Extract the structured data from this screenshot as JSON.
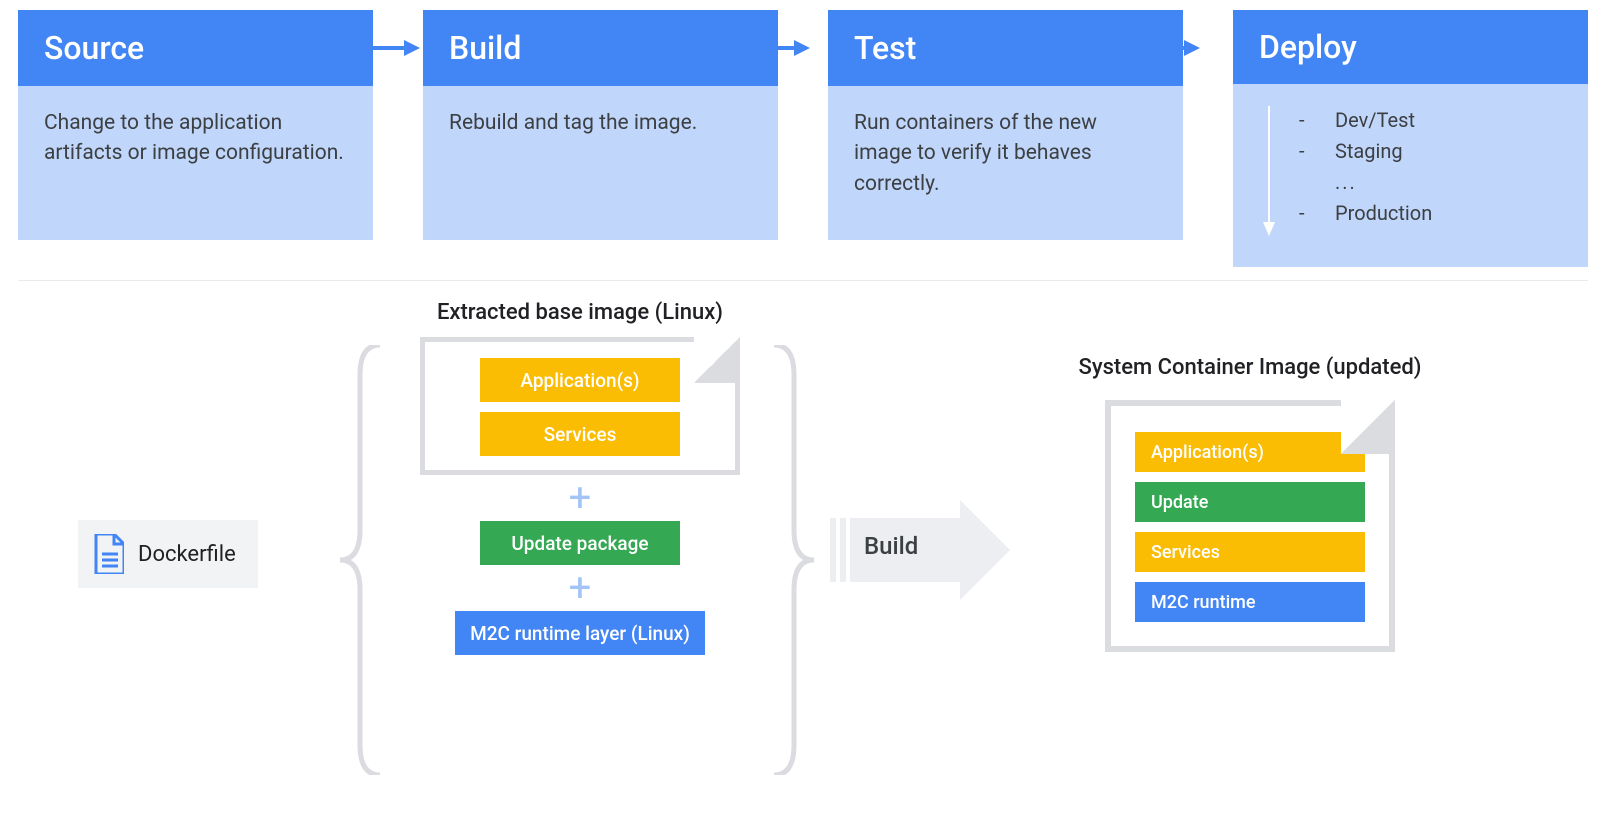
{
  "pipeline": {
    "stages": [
      {
        "title": "Source",
        "body": "Change to the application artifacts or image configuration."
      },
      {
        "title": "Build",
        "body": "Rebuild and tag the image."
      },
      {
        "title": "Test",
        "body": "Run containers of the new image to verify it behaves correctly."
      },
      {
        "title": "Deploy",
        "items": [
          "Dev/Test",
          "Staging",
          "Production"
        ],
        "ellipsis": "..."
      }
    ]
  },
  "lower": {
    "dockerfile_label": "Dockerfile",
    "extracted_title": "Extracted base image (Linux)",
    "extracted_layers": {
      "app": "Application(s)",
      "services": "Services"
    },
    "update_package": "Update package",
    "m2c_runtime": "M2C runtime layer (Linux)",
    "plus": "+",
    "build_label": "Build",
    "result_title": "System Container Image (updated)",
    "result_layers": {
      "app": "Application(s)",
      "update": "Update",
      "services": "Services",
      "m2c": "M2C runtime"
    }
  }
}
